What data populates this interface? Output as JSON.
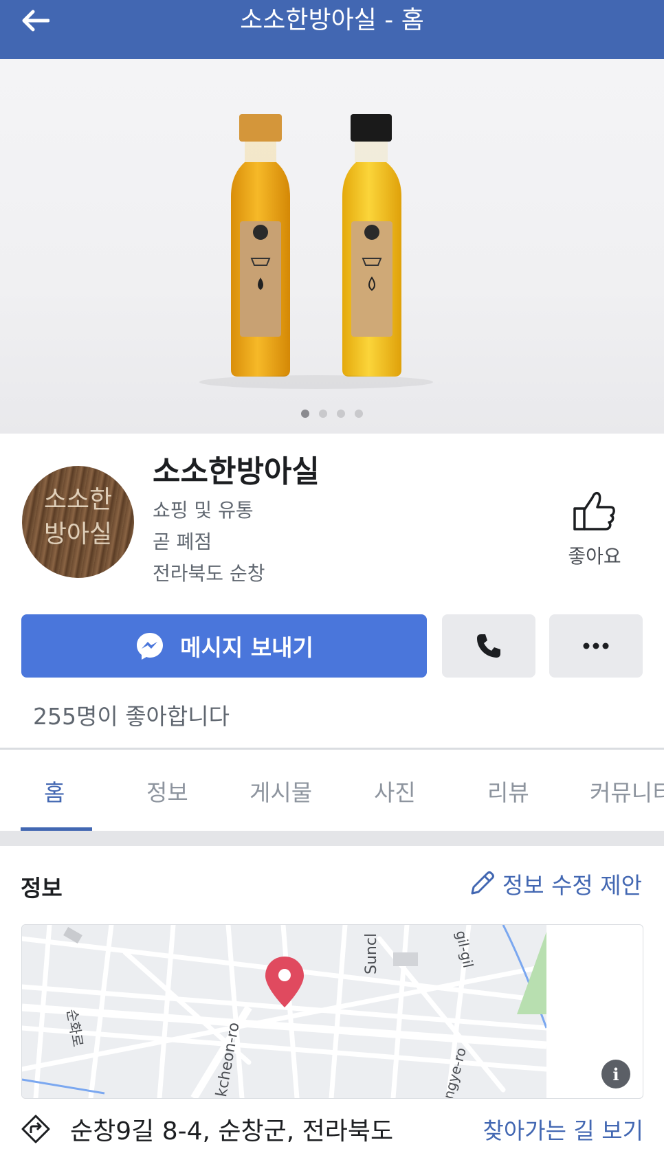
{
  "header": {
    "title": "소소한방아실 - 홈",
    "back_icon": "arrow-left-icon"
  },
  "cover": {
    "slide_count": 4,
    "active_slide": 1
  },
  "profile": {
    "name": "소소한방아실",
    "avatar_text_line1": "소소한",
    "avatar_text_line2": "방아실",
    "category": "쇼핑 및 유통",
    "status": "곧 폐점",
    "location": "전라북도 순창"
  },
  "like_button": {
    "label": "좋아요",
    "icon": "thumbs-up-icon"
  },
  "actions": {
    "message_label": "메시지 보내기",
    "message_icon": "messenger-icon",
    "call_icon": "phone-icon",
    "more_icon": "more-dots-icon"
  },
  "likes_count_text": "255명이 좋아합니다",
  "tabs": [
    {
      "label": "홈",
      "active": true
    },
    {
      "label": "정보",
      "active": false
    },
    {
      "label": "게시물",
      "active": false
    },
    {
      "label": "사진",
      "active": false
    },
    {
      "label": "리뷰",
      "active": false
    },
    {
      "label": "커뮤니티",
      "active": false
    }
  ],
  "info_section": {
    "title": "정보",
    "suggest_edit_label": "정보 수정 제안",
    "suggest_edit_icon": "pencil-icon"
  },
  "map": {
    "labels": [
      "순화로",
      "kcheon-ro",
      "Suncl",
      "gil-gil",
      "ngye-ro"
    ],
    "pin_icon": "map-pin-icon",
    "info_icon": "info-icon"
  },
  "address": {
    "text": "순창9길 8-4, 순창군, 전라북도",
    "directions_label": "찾아가는 길 보기",
    "icon": "directions-icon"
  },
  "colors": {
    "brand_blue": "#4267b2",
    "message_button": "#4a76db",
    "pin_red": "#e04a5f"
  }
}
